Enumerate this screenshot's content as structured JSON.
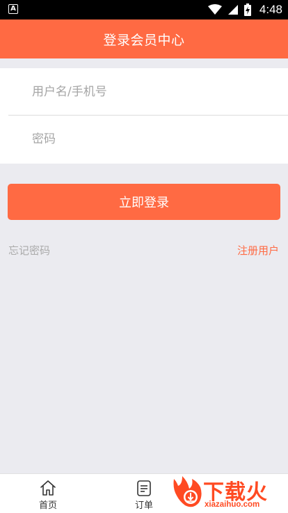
{
  "status_bar": {
    "notification_icon": "a-icon",
    "time": "4:48"
  },
  "header": {
    "title": "登录会员中心"
  },
  "form": {
    "username_placeholder": "用户名/手机号",
    "username_value": "",
    "password_placeholder": "密码",
    "password_value": ""
  },
  "actions": {
    "login_label": "立即登录",
    "forgot_password": "忘记密码",
    "register": "注册用户"
  },
  "tab_bar": {
    "items": [
      {
        "label": "首页",
        "icon": "home-icon"
      },
      {
        "label": "订单",
        "icon": "document-icon"
      }
    ]
  },
  "watermark": {
    "text": "下载火",
    "url": "xiazaihuo.com"
  },
  "colors": {
    "accent": "#ff6a43",
    "background": "#ebebf0",
    "muted_text": "#aaaaaa"
  }
}
